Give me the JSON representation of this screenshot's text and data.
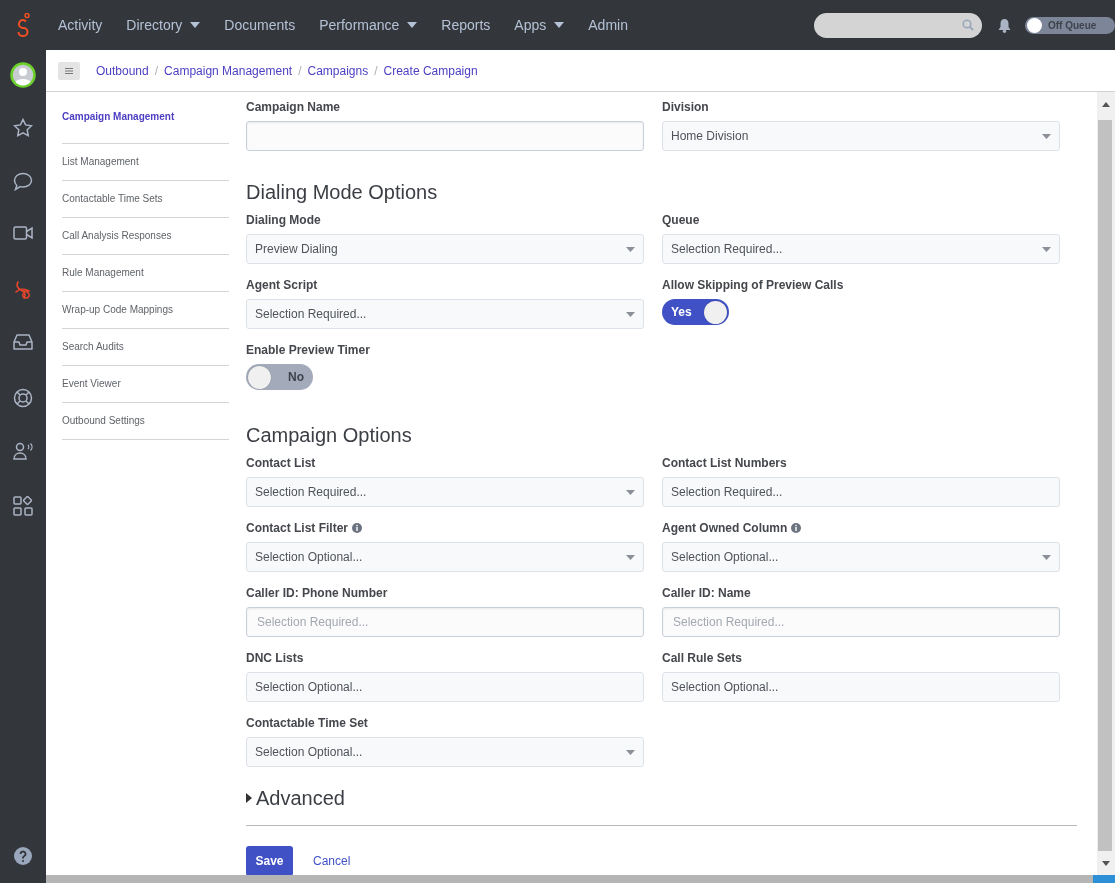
{
  "top_nav": {
    "items": [
      {
        "label": "Activity",
        "has_menu": false
      },
      {
        "label": "Directory",
        "has_menu": true
      },
      {
        "label": "Documents",
        "has_menu": false
      },
      {
        "label": "Performance",
        "has_menu": true
      },
      {
        "label": "Reports",
        "has_menu": false
      },
      {
        "label": "Apps",
        "has_menu": true
      },
      {
        "label": "Admin",
        "has_menu": false
      }
    ],
    "queue_toggle": {
      "label": "Off Queue",
      "on": false
    }
  },
  "rail": {
    "items": [
      {
        "kind": "star",
        "selected": false
      },
      {
        "kind": "chat",
        "selected": false
      },
      {
        "kind": "video",
        "selected": false
      },
      {
        "kind": "outbound",
        "selected": true
      },
      {
        "kind": "inbox",
        "selected": false
      },
      {
        "kind": "lifebuoy",
        "selected": false
      },
      {
        "kind": "speaker",
        "selected": false
      },
      {
        "kind": "apps",
        "selected": false
      }
    ]
  },
  "breadcrumb": {
    "separator": "/",
    "items": [
      "Outbound",
      "Campaign Management",
      "Campaigns",
      "Create Campaign"
    ]
  },
  "side_nav": {
    "items": [
      {
        "label": "Campaign Management",
        "selected": true
      },
      {
        "label": "List Management",
        "selected": false
      },
      {
        "label": "Contactable Time Sets",
        "selected": false
      },
      {
        "label": "Call Analysis Responses",
        "selected": false
      },
      {
        "label": "Rule Management",
        "selected": false
      },
      {
        "label": "Wrap-up Code Mappings",
        "selected": false
      },
      {
        "label": "Search Audits",
        "selected": false
      },
      {
        "label": "Event Viewer",
        "selected": false
      },
      {
        "label": "Outbound Settings",
        "selected": false
      }
    ]
  },
  "form": {
    "sections": [
      {
        "fields": [
          {
            "label": "Campaign Name",
            "kind": "text"
          },
          {
            "label": "Division",
            "kind": "select",
            "value": "Home Division"
          }
        ]
      },
      {
        "heading": "Dialing Mode Options",
        "fields": [
          {
            "label": "Dialing Mode",
            "kind": "select",
            "value": "Preview Dialing"
          },
          {
            "label": "Queue",
            "kind": "select",
            "value": "Selection Required..."
          },
          {
            "label": "Agent Script",
            "kind": "select",
            "value": "Selection Required..."
          },
          {
            "label": "Allow Skipping of Preview Calls",
            "kind": "toggle",
            "on": true,
            "value": "Yes"
          },
          {
            "label": "Enable Preview Timer",
            "kind": "toggle",
            "on": false,
            "value": "No"
          }
        ]
      },
      {
        "heading": "Campaign Options",
        "fields": [
          {
            "label": "Contact List",
            "kind": "select",
            "value": "Selection Required..."
          },
          {
            "label": "Contact List Numbers",
            "kind": "static",
            "value": "Selection Required..."
          },
          {
            "label": "Contact List Filter",
            "kind": "select",
            "value": "Selection Optional...",
            "info": true
          },
          {
            "label": "Agent Owned Column",
            "kind": "select",
            "value": "Selection Optional...",
            "info": true
          },
          {
            "label": "Caller ID: Phone Number",
            "kind": "text",
            "placeholder": "Selection Required..."
          },
          {
            "label": "Caller ID: Name",
            "kind": "text",
            "placeholder": "Selection Required..."
          },
          {
            "label": "DNC Lists",
            "kind": "static",
            "value": "Selection Optional..."
          },
          {
            "label": "Call Rule Sets",
            "kind": "static",
            "value": "Selection Optional..."
          },
          {
            "label": "Contactable Time Set",
            "kind": "select",
            "value": "Selection Optional..."
          }
        ]
      }
    ]
  },
  "advanced": {
    "label": "Advanced",
    "expanded": false
  },
  "actions": {
    "save": "Save",
    "cancel": "Cancel"
  }
}
